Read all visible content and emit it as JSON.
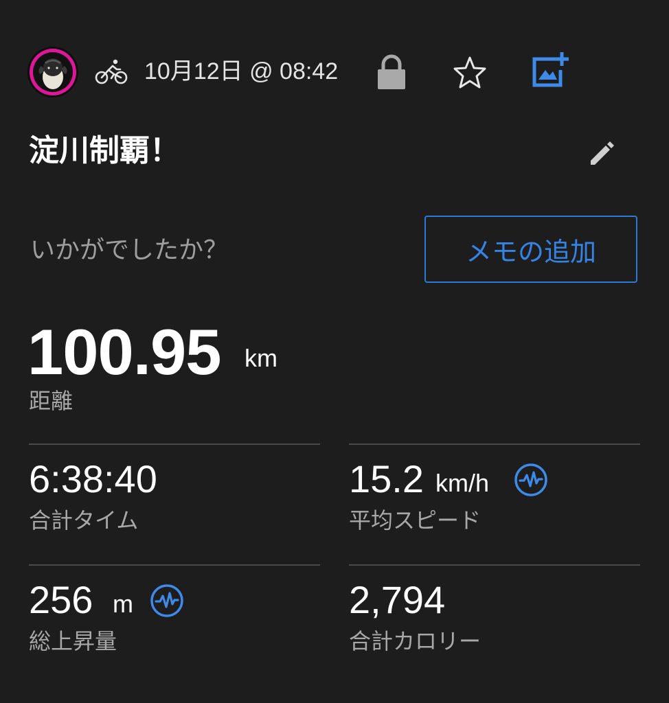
{
  "header": {
    "date_time": "10月12日 @ 08:42",
    "activity_icon": "cycling-icon",
    "privacy_icon": "lock-icon",
    "favorite_icon": "star-outline-icon",
    "add_photo_icon": "add-photo-icon"
  },
  "activity": {
    "title": "淀川制覇！",
    "edit_icon": "pencil-icon"
  },
  "feedback": {
    "prompt": "いかがでしたか？",
    "memo_button": "メモの追加"
  },
  "distance": {
    "value": "100.95",
    "unit": "km",
    "label": "距離"
  },
  "stats": {
    "total_time": {
      "value": "6:38:40",
      "label": "合計タイム"
    },
    "avg_speed": {
      "value": "15.2",
      "unit": "km/h",
      "label": "平均スピード",
      "icon": "pulse-graph-icon"
    },
    "elevation_gain": {
      "value": "256",
      "unit": "m",
      "label": "総上昇量",
      "icon": "pulse-graph-icon"
    },
    "calories": {
      "value": "2,794",
      "label": "合計カロリー"
    }
  },
  "colors": {
    "background": "#1d1d1d",
    "accent_blue": "#3584e4",
    "avatar_ring": "#e0169a",
    "muted_text": "#a8a8a8"
  }
}
